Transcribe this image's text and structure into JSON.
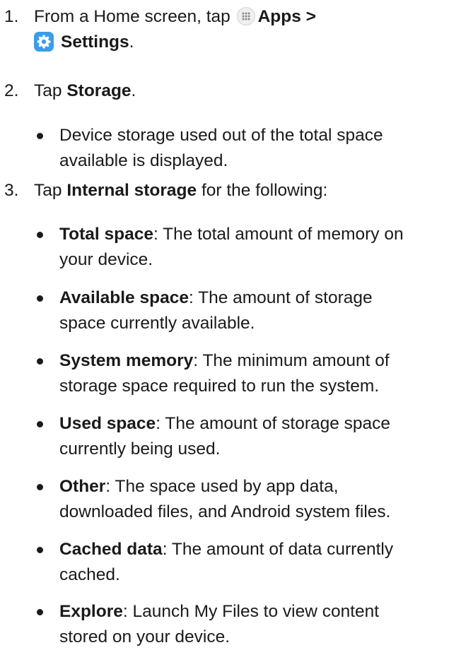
{
  "steps": [
    {
      "number": "1.",
      "prefix": "From a Home screen, tap",
      "apps_label": "Apps",
      "separator": ">",
      "settings_label": "Settings",
      "suffix": "."
    },
    {
      "number": "2.",
      "prefix": "Tap",
      "bold": "Storage",
      "suffix": "."
    },
    {
      "number": "3.",
      "prefix": "Tap",
      "bold": "Internal storage",
      "suffix": "for the following:"
    }
  ],
  "step2_bullet": {
    "line1": "Device storage used out of the total space",
    "line2": "available is displayed."
  },
  "step3_bullets": [
    {
      "term": "Total space",
      "line1": ": The total amount of memory on",
      "line2": "your device."
    },
    {
      "term": "Available space",
      "line1": ": The amount of storage",
      "line2": "space currently available."
    },
    {
      "term": "System memory",
      "line1": ": The minimum amount of",
      "line2": "storage space required to run the system."
    },
    {
      "term": "Used space",
      "line1": ": The amount of storage space",
      "line2": "currently being used."
    },
    {
      "term": "Other",
      "line1": ": The space used by app data,",
      "line2": "downloaded files, and Android system files."
    },
    {
      "term": "Cached data",
      "line1": ": The amount of data currently",
      "line2": "cached."
    },
    {
      "term": "Explore",
      "line1": ": Launch My Files to view content",
      "line2": "stored on your device."
    }
  ],
  "icons": {
    "apps": "apps-grid-icon",
    "settings": "settings-gear-icon",
    "settings_color": "#3a9ee6"
  }
}
